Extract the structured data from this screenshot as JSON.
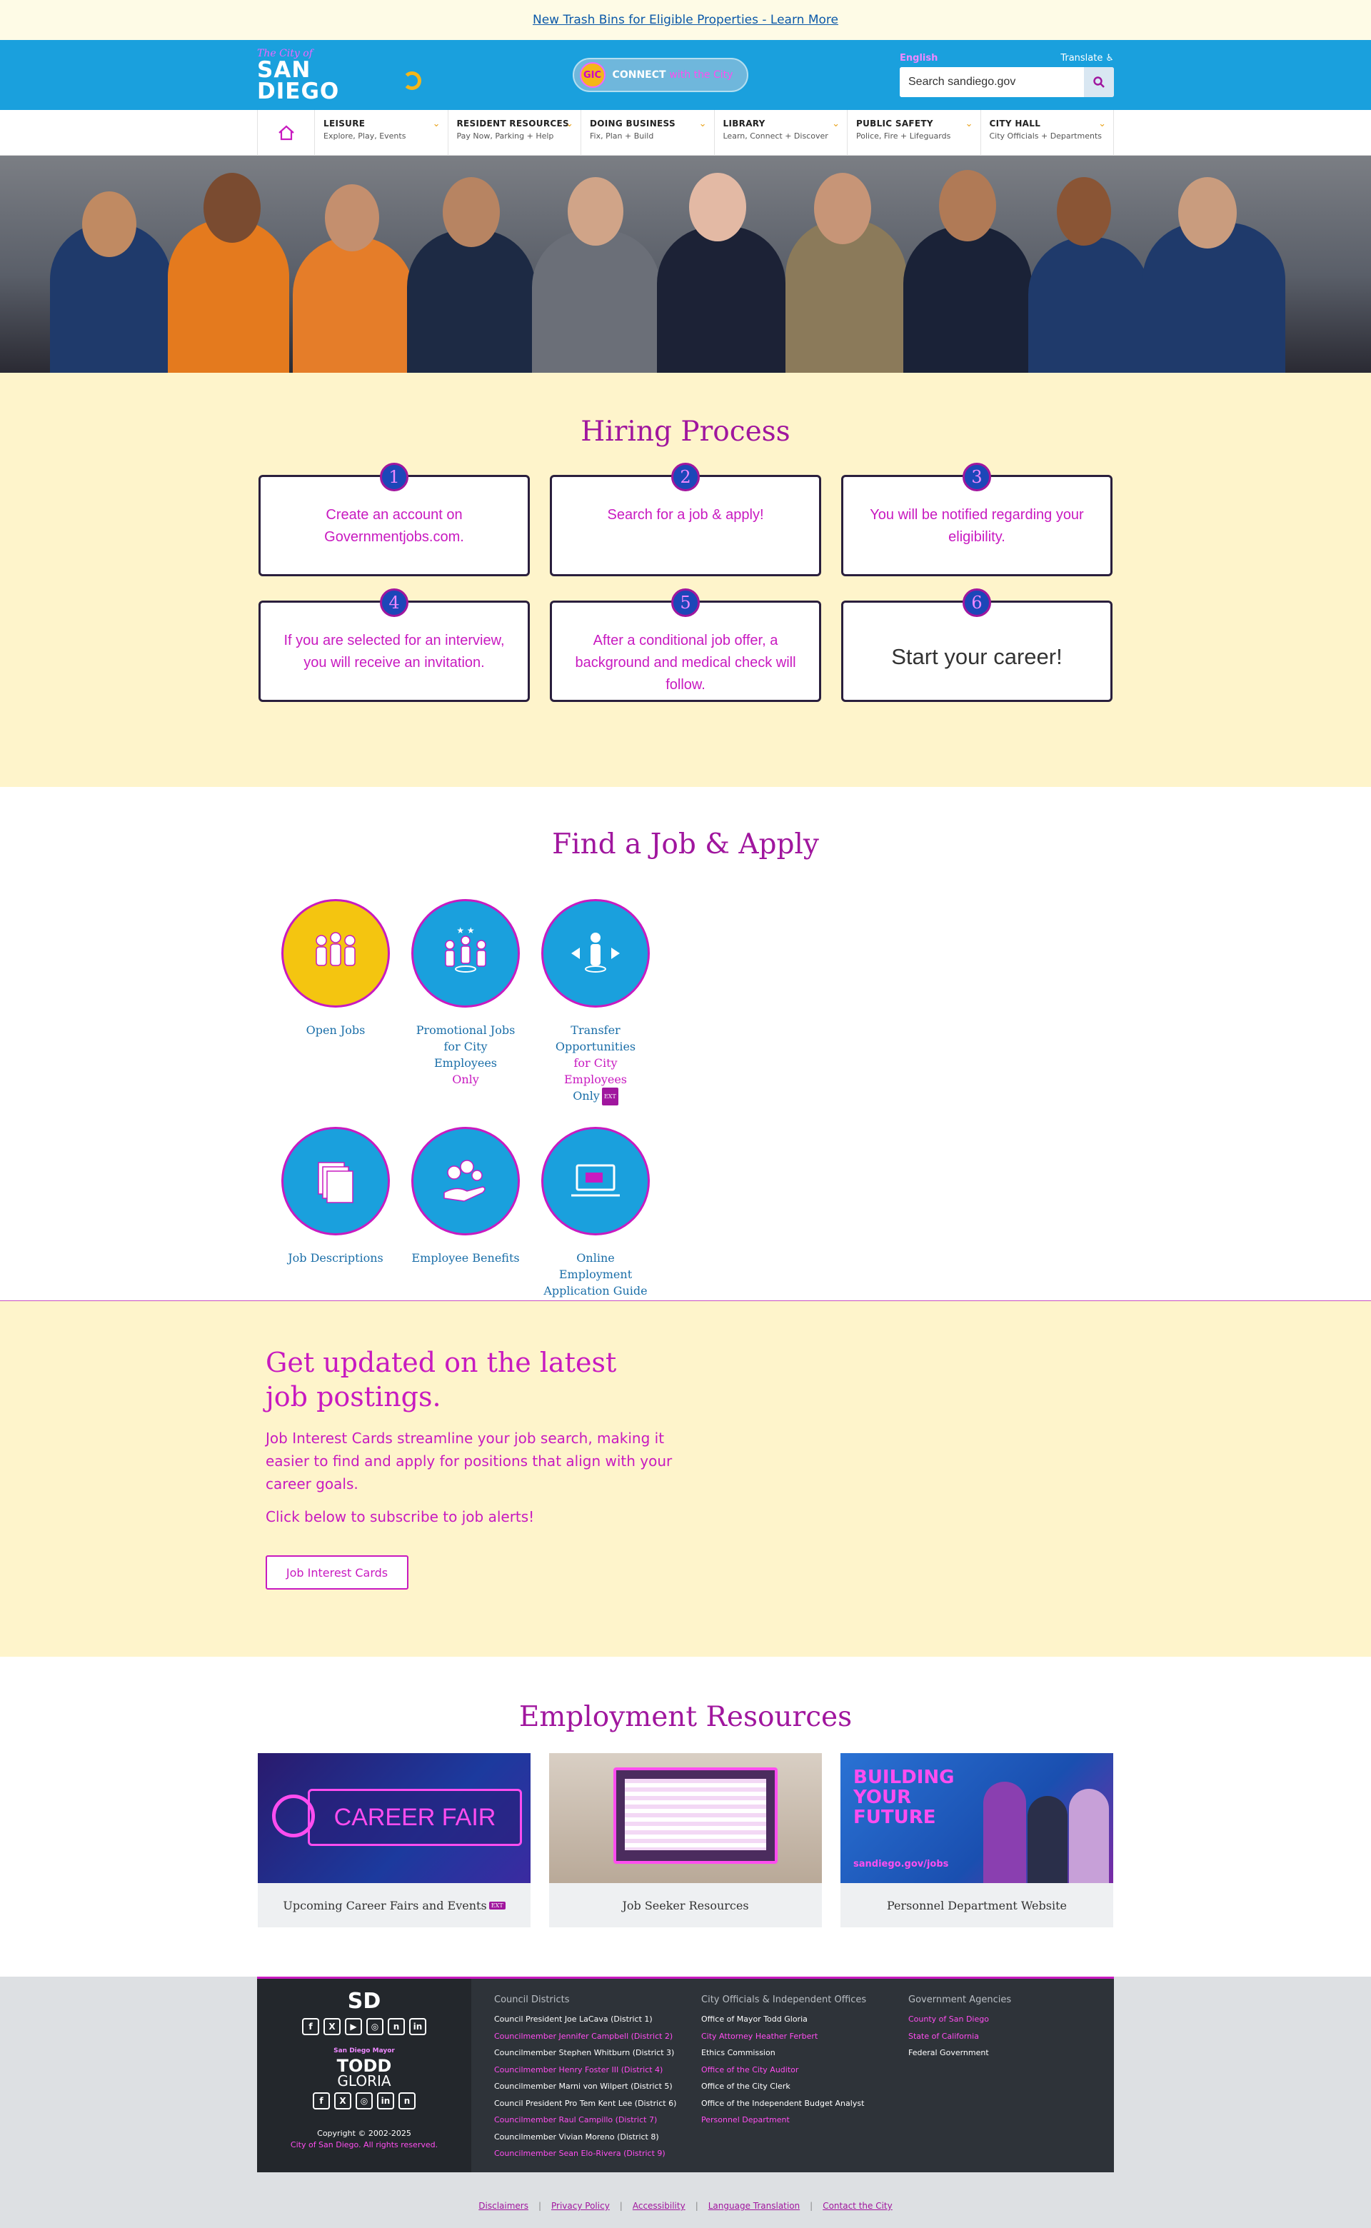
{
  "alert": {
    "text": "New Trash Bins for Eligible Properties - Learn More"
  },
  "header": {
    "logo_small": "The City of",
    "logo_big": "SAN DIEGO",
    "connect_badge": "GIC",
    "connect_label": "CONNECT",
    "connect_suffix": "with the City",
    "language": "English",
    "access": "Translate",
    "search_placeholder": "Search sandiego.gov"
  },
  "nav": {
    "items": [
      {
        "title": "LEISURE",
        "sub": "Explore, Play, Events"
      },
      {
        "title": "RESIDENT RESOURCES",
        "sub": "Pay Now, Parking + Help"
      },
      {
        "title": "DOING BUSINESS",
        "sub": "Fix, Plan + Build"
      },
      {
        "title": "LIBRARY",
        "sub": "Learn, Connect + Discover"
      },
      {
        "title": "PUBLIC SAFETY",
        "sub": "Police, Fire + Lifeguards"
      },
      {
        "title": "CITY HALL",
        "sub": "City Officials + Departments"
      }
    ]
  },
  "hiring": {
    "title": "Hiring Process",
    "steps": [
      {
        "num": "1",
        "text": "Create an account on Governmentjobs.com."
      },
      {
        "num": "2",
        "text": "Search for a job & apply!"
      },
      {
        "num": "3",
        "text": "You will be notified regarding your eligibility."
      },
      {
        "num": "4",
        "text": "If you are selected for an interview, you will receive an invitation."
      },
      {
        "num": "5",
        "text": "After a conditional job offer, a background and medical check will follow."
      },
      {
        "num": "6",
        "text": "Start your career!"
      }
    ]
  },
  "findjob": {
    "title": "Find a Job & Apply",
    "cards": [
      {
        "line1": "Open Jobs",
        "line2": "",
        "line3": "",
        "bg": "#f4c510"
      },
      {
        "line1": "Promotional Jobs",
        "line2": "for City Employees",
        "line3": "Only",
        "bg": "#1aa0dd"
      },
      {
        "line1": "Transfer",
        "line2": "Opportunities",
        "line3": "for City Employees",
        "line4": "Only",
        "bg": "#1aa0dd"
      },
      {
        "line1": "Job Descriptions",
        "line2": "",
        "line3": "",
        "bg": "#1aa0dd"
      },
      {
        "line1": "Employee Benefits",
        "line2": "",
        "line3": "",
        "bg": "#1aa0dd"
      },
      {
        "line1": "Online Employment",
        "line2": "Application Guide",
        "line3": "",
        "bg": "#1aa0dd"
      }
    ],
    "ext_label": "EXT"
  },
  "updates": {
    "title": "Get updated on the latest job postings.",
    "body": "Job Interest Cards streamline your job search, making it easier to find and apply for positions that align with your career goals.",
    "cta_text": "Click below to subscribe to job alerts!",
    "button": "Job Interest Cards"
  },
  "resources": {
    "title": "Employment Resources",
    "cards": [
      {
        "caption": "Upcoming Career Fairs and Events",
        "banner": "CAREER FAIR"
      },
      {
        "caption": "Job Seeker Resources",
        "banner": ""
      },
      {
        "caption": "Personnel Department Website",
        "banner": "BUILDING YOUR FUTURE",
        "banner_sub": "sandiego.gov/jobs"
      }
    ]
  },
  "footer": {
    "sd": "SD",
    "mayor_1": "San Diego Mayor",
    "mayor_2": "TODD",
    "mayor_3": "GLORIA",
    "copyright": "Copyright © 2002-2025",
    "rights": "City of San Diego. All rights reserved.",
    "col1_title": "Council Districts",
    "col1": [
      "Council President Joe LaCava (District 1)",
      "Councilmember Jennifer Campbell (District 2)",
      "Councilmember Stephen Whitburn (District 3)",
      "Councilmember Henry Foster III (District 4)",
      "Councilmember Marni von Wilpert (District 5)",
      "Council President Pro Tem Kent Lee (District 6)",
      "Councilmember Raul Campillo (District 7)",
      "Councilmember Vivian Moreno (District 8)",
      "Councilmember Sean Elo-Rivera (District 9)"
    ],
    "col2_title": "City Officials & Independent Offices",
    "col2": [
      "Office of Mayor Todd Gloria",
      "City Attorney Heather Ferbert",
      "Ethics Commission",
      "Office of the City Auditor",
      "Office of the City Clerk",
      "Office of the Independent Budget Analyst",
      "Personnel Department"
    ],
    "col3_title": "Government Agencies",
    "col3": [
      "County of San Diego",
      "State of California",
      "Federal Government"
    ],
    "bottom": [
      "Disclaimers",
      "Privacy Policy",
      "Accessibility",
      "Language Translation",
      "Contact the City"
    ]
  }
}
